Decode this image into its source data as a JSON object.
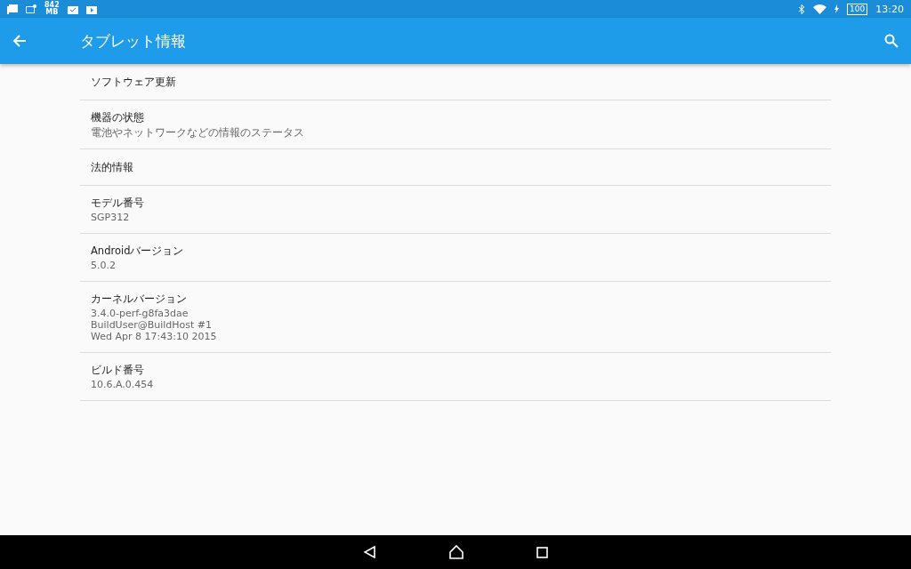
{
  "status_bar": {
    "memory_value": "842",
    "memory_unit": "MB",
    "battery": "100",
    "time": "13:20"
  },
  "app_bar": {
    "title": "タブレット情報"
  },
  "items": [
    {
      "title": "ソフトウェア更新"
    },
    {
      "title": "機器の状態",
      "summary": [
        "電池やネットワークなどの情報のステータス"
      ]
    },
    {
      "title": "法的情報"
    },
    {
      "title": "モデル番号",
      "summary": [
        "SGP312"
      ]
    },
    {
      "title": "Androidバージョン",
      "summary": [
        "5.0.2"
      ]
    },
    {
      "title": "カーネルバージョン",
      "summary": [
        "3.4.0-perf-g8fa3dae",
        "BuildUser@BuildHost #1",
        "Wed Apr 8 17:43:10 2015"
      ]
    },
    {
      "title": "ビルド番号",
      "summary": [
        "10.6.A.0.454"
      ]
    }
  ]
}
